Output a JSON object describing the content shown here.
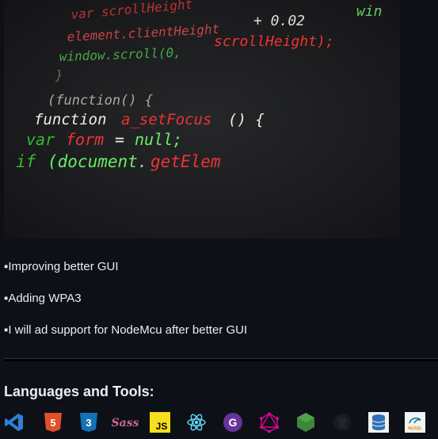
{
  "hero_code": {
    "lines": [
      "var scrollHeight + 0.02 * win",
      "element.clientHeight scrollHeight);",
      "window.scroll(0,",
      "}",
      "(function() {",
      "function a_setFocus() {",
      "var form = null;",
      "if (document.getElem"
    ]
  },
  "bullets": [
    "▪Improving better GUI",
    "▪Adding WPA3",
    "▪I will ad support for NodeMcu after better GUI"
  ],
  "languages_heading": "Languages and Tools:",
  "tools": [
    {
      "name": "vscode-icon",
      "label": "",
      "color": "#2f80d6"
    },
    {
      "name": "html5-icon",
      "label": "5",
      "color": "#e34f26"
    },
    {
      "name": "css3-icon",
      "label": "3",
      "color": "#1572b6"
    },
    {
      "name": "sass-icon",
      "label": "Sass",
      "color": "#cc6699"
    },
    {
      "name": "javascript-icon",
      "label": "JS",
      "color": "#f7df1e"
    },
    {
      "name": "react-icon",
      "label": "",
      "color": "#61dafb"
    },
    {
      "name": "gatsby-icon",
      "label": "G",
      "color": "#663399"
    },
    {
      "name": "graphql-icon",
      "label": "",
      "color": "#e10098"
    },
    {
      "name": "nodejs-icon",
      "label": "",
      "color": "#3c873a"
    },
    {
      "name": "github-icon",
      "label": "",
      "color": "#161b22"
    },
    {
      "name": "database-icon",
      "label": "",
      "color": "#2f6fb5"
    },
    {
      "name": "mysql-icon",
      "label": "MySQL",
      "color": "#f2f2f2"
    }
  ]
}
